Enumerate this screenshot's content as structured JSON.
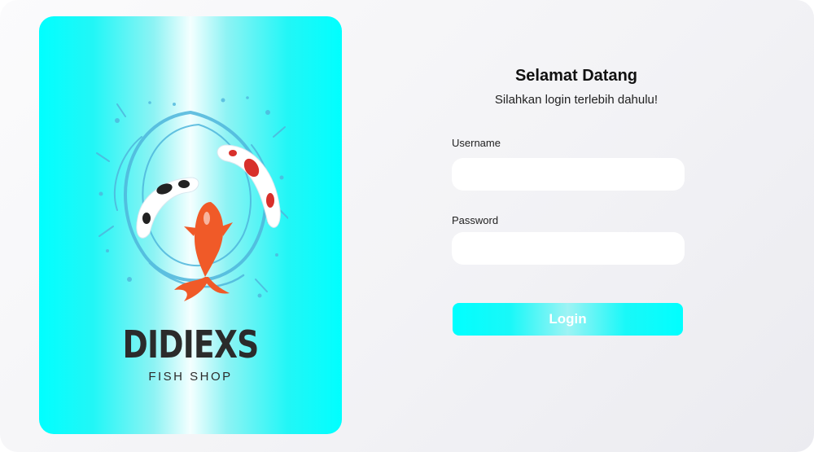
{
  "brand": {
    "name": "DIDIEXS",
    "tagline": "FISH SHOP"
  },
  "login": {
    "title": "Selamat Datang",
    "subtitle": "Silahkan login terlebih dahulu!",
    "username_label": "Username",
    "username_value": "",
    "password_label": "Password",
    "password_value": "",
    "button_label": "Login"
  },
  "colors": {
    "accent": "#00ffff",
    "koi_orange": "#f05a28",
    "koi_red": "#d8302b",
    "koi_black": "#222222",
    "water": "#4fb6dc",
    "text_dark": "#2b2b2b"
  },
  "icons": {
    "logo": "koi-fish-splash-icon"
  }
}
